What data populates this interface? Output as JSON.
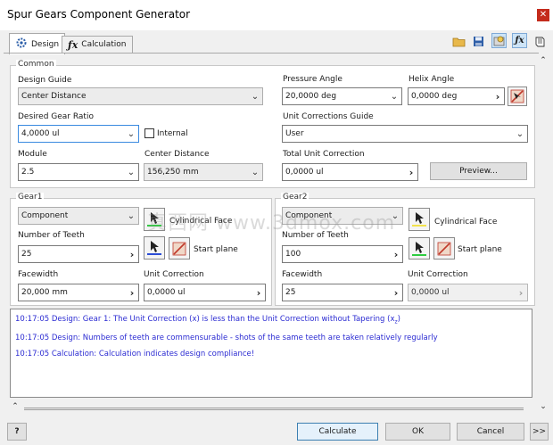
{
  "window": {
    "title": "Spur Gears Component Generator",
    "close_glyph": "✕"
  },
  "tabs": [
    {
      "label": "Design",
      "icon": "gear-design-icon"
    },
    {
      "label": "Calculation",
      "icon": "calculation-fx-icon"
    }
  ],
  "toolbar": [
    "open-folder-icon",
    "save-icon",
    "settings-icon",
    "fx-calculation-icon",
    "book-icon"
  ],
  "common": {
    "label": "Common",
    "design_guide": {
      "label": "Design Guide",
      "value": "Center Distance"
    },
    "desired_gear_ratio": {
      "label": "Desired Gear Ratio",
      "value": "4,0000 ul"
    },
    "internal": {
      "label": "Internal",
      "checked": false
    },
    "module": {
      "label": "Module",
      "value": "2.5"
    },
    "center_distance": {
      "label": "Center Distance",
      "value": "156,250 mm"
    },
    "pressure_angle": {
      "label": "Pressure Angle",
      "value": "20,0000 deg"
    },
    "helix_angle": {
      "label": "Helix Angle",
      "value": "0,0000 deg"
    },
    "unit_corrections_guide": {
      "label": "Unit Corrections Guide",
      "value": "User"
    },
    "total_unit_correction": {
      "label": "Total Unit Correction",
      "value": "0,0000 ul"
    },
    "preview_button": "Preview..."
  },
  "gear1": {
    "label": "Gear1",
    "type": "Component",
    "face_label": "Cylindrical Face",
    "number_of_teeth": {
      "label": "Number of Teeth",
      "value": "25"
    },
    "start_plane_label": "Start plane",
    "facewidth": {
      "label": "Facewidth",
      "value": "20,000 mm"
    },
    "unit_correction": {
      "label": "Unit Correction",
      "value": "0,0000 ul"
    }
  },
  "gear2": {
    "label": "Gear2",
    "type": "Component",
    "face_label": "Cylindrical Face",
    "number_of_teeth": {
      "label": "Number of Teeth",
      "value": "100"
    },
    "start_plane_label": "Start plane",
    "facewidth": {
      "label": "Facewidth",
      "value": "25"
    },
    "unit_correction": {
      "label": "Unit Correction",
      "value": "0,0000 ul"
    }
  },
  "messages": {
    "line1_main": "10:17:05 Design: Gear 1: The Unit Correction (x) is less than the Unit Correction without Tapering (x",
    "line1_sub": "z",
    "line1_end": ")",
    "line2": "10:17:05 Design: Numbers of teeth are commensurable - shots of the same teeth are taken relatively regularly",
    "line3": "10:17:05 Calculation: Calculation indicates design compliance!"
  },
  "watermark": "真西网 www.3dmox.com",
  "bottom": {
    "help_glyph": "?",
    "calculate": "Calculate",
    "ok": "OK",
    "cancel": "Cancel",
    "more": ">>"
  },
  "colors": {
    "message_text": "#2b2bd2",
    "accent": "#3a8ae0",
    "close": "#c42b1c"
  }
}
